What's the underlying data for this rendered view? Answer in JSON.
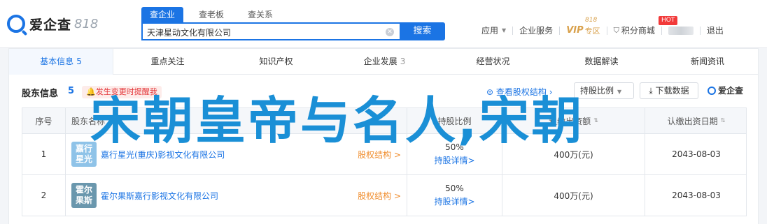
{
  "brand": {
    "name": "爱企查",
    "suffix": "818"
  },
  "search": {
    "tabs": [
      "查企业",
      "查老板",
      "查关系"
    ],
    "value": "天津星动文化有限公司",
    "button": "搜索"
  },
  "topnav": {
    "apps": "应用",
    "enterprise": "企业服务",
    "vip": "VIP",
    "vip_sub": "专区",
    "vip_num": "818",
    "points": "积分商城",
    "hot": "HOT",
    "logout": "退出"
  },
  "tabs": [
    {
      "label": "基本信息",
      "count": "5"
    },
    {
      "label": "重点关注",
      "count": ""
    },
    {
      "label": "知识产权",
      "count": ""
    },
    {
      "label": "企业发展",
      "count": "3"
    },
    {
      "label": "经营状况",
      "count": ""
    },
    {
      "label": "数据解读",
      "count": ""
    },
    {
      "label": "新闻资讯",
      "count": ""
    }
  ],
  "section": {
    "title": "股东信息",
    "count": "5",
    "alert": "发生变更时提醒我",
    "view_structure": "查看股权结构",
    "dropdown": "持股比例",
    "download": "下载数据",
    "watermark": "爱企查"
  },
  "table": {
    "headers": [
      "序号",
      "股东名称",
      "持股比例",
      "认缴出资额",
      "认缴出资日期"
    ],
    "rows": [
      {
        "index": "1",
        "logo_text": "嘉行星光",
        "logo_color": "#8fc3e8",
        "name": "嘉行星光(重庆)影视文化有限公司",
        "equity": "股权结构 >",
        "percent": "50%",
        "detail": "持股详情>",
        "capital": "400万(元)",
        "date": "2043-08-03"
      },
      {
        "index": "2",
        "logo_text": "霍尔果斯",
        "logo_color": "#6a97ad",
        "name": "霍尔果斯嘉行影视文化有限公司",
        "equity": "股权结构 >",
        "percent": "50%",
        "detail": "持股详情>",
        "capital": "400万(元)",
        "date": "2043-08-03"
      }
    ]
  },
  "overlay_text": "宋朝皇帝与名人,宋朝"
}
